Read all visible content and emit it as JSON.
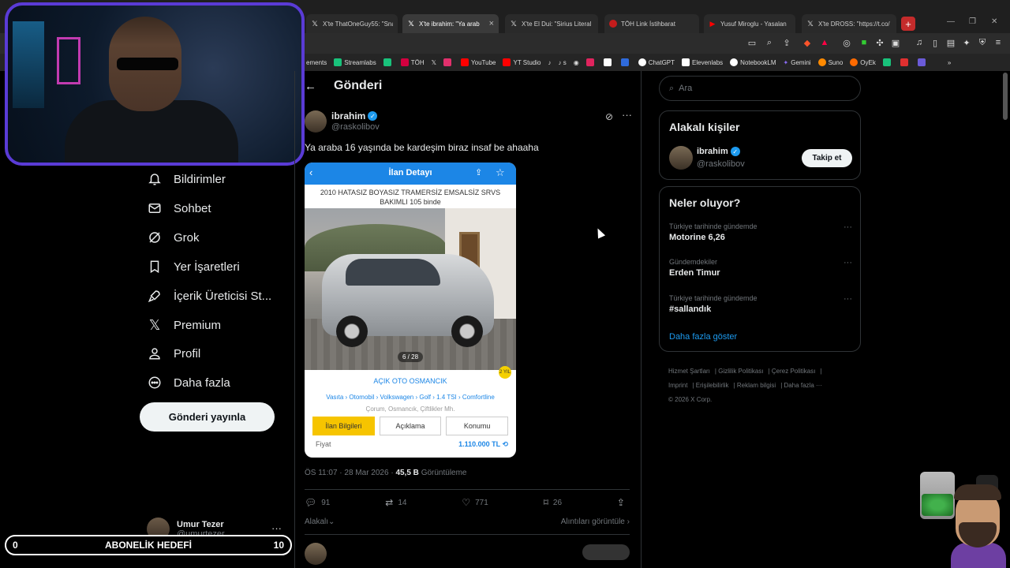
{
  "browser": {
    "tabs": [
      {
        "title": "X'te ThatOneGuy55: \"Snap",
        "active": false
      },
      {
        "title": "X'te ibrahim: \"Ya arab",
        "active": true
      },
      {
        "title": "X'te El Dui: \"Sirius Literal E",
        "active": false
      },
      {
        "title": "TÖH Link İstihbarat",
        "active": false
      },
      {
        "title": "Yusuf Miroglu - Yasalan",
        "active": false
      },
      {
        "title": "X'te DROSS: \"https://t.co/",
        "active": false
      }
    ],
    "bookmarks": [
      "ements",
      "Streamlabs",
      "TÖH",
      "YouTube",
      "YT Studio",
      "s",
      "ChatGPT",
      "Elevenlabs",
      "NotebookLM",
      "Gemini",
      "Suno",
      "OyEk"
    ],
    "bookmark_colors": [
      "#888888",
      "#19c27b",
      "#19c27b",
      "#d3003f",
      "#ffffff",
      "#ff0000",
      "#ff0000",
      "#444444",
      "#ffffff",
      "#ffffff",
      "#ffffff",
      "#8a6cf7",
      "#ff8a00",
      "#ff6a00"
    ]
  },
  "nav": {
    "items": [
      {
        "label": "Bildirimler",
        "icon": "bell-icon"
      },
      {
        "label": "Sohbet",
        "icon": "mail-icon"
      },
      {
        "label": "Grok",
        "icon": "grok-icon"
      },
      {
        "label": "Yer İşaretleri",
        "icon": "bookmark-icon"
      },
      {
        "label": "İçerik Üreticisi St...",
        "icon": "rocket-icon"
      },
      {
        "label": "Premium",
        "icon": "x-logo-icon"
      },
      {
        "label": "Profil",
        "icon": "person-icon"
      },
      {
        "label": "Daha fazla",
        "icon": "more-circle-icon"
      }
    ],
    "post_button": "Gönderi yayınla",
    "account": {
      "name": "Umur Tezer",
      "handle": "@umurtezer"
    }
  },
  "overlay": {
    "goal_left": "0",
    "goal_label": "ABONELİK HEDEFİ",
    "goal_right": "10",
    "goal_progress": 0
  },
  "post": {
    "page_title": "Gönderi",
    "author": "ibrahim",
    "handle": "@raskolibov",
    "text": "Ya araba 16 yaşında be kardeşim biraz insaf be ahaaha",
    "embed": {
      "header": "İlan Detayı",
      "title": "2010 HATASIZ BOYASIZ TRAMERSİZ EMSALSİZ SRVS BAKIMLI 105 binde",
      "photo_counter": "6 / 28",
      "dealer": "AÇIK OTO OSMANCIK",
      "breadcrumb": "Vasıta › Otomobil › Volkswagen › Golf › 1.4 TSI › Comfortline",
      "location": "Çorum, Osmancık, Çiftlikler Mh.",
      "tabs": [
        "İlan Bilgileri",
        "Açıklama",
        "Konumu"
      ],
      "price_label": "Fiyat",
      "price_value": "1.110.000 TL",
      "badge": "2 YIL"
    },
    "timestamp": "ÖS 11:07 · 28 Mar 2026 ·",
    "views_value": "45,5 B",
    "views_label": "Görüntüleme",
    "stats": {
      "replies": "91",
      "reposts": "14",
      "likes": "771",
      "bookmarks": "26"
    },
    "related_label": "Alakalı",
    "quotes_label": "Alıntıları görüntüle"
  },
  "sidebar": {
    "search_placeholder": "Ara",
    "related_title": "Alakalı kişiler",
    "related_user": {
      "name": "ibrahim",
      "handle": "@raskolibov",
      "button": "Takip et"
    },
    "trends_title": "Neler oluyor?",
    "trends": [
      {
        "context": "Türkiye tarihinde gündemde",
        "topic": "Motorine 6,26"
      },
      {
        "context": "Gündemdekiler",
        "topic": "Erden Timur"
      },
      {
        "context": "Türkiye tarihinde gündemde",
        "topic": "#sallandık"
      }
    ],
    "show_more": "Daha fazla göster",
    "footer": [
      "Hizmet Şartları",
      "Gizlilik Politikası",
      "Çerez Politikası",
      "Imprint",
      "Erişilebilirlik",
      "Reklam bilgisi",
      "Daha fazla ···",
      "© 2026 X Corp."
    ]
  },
  "colors": {
    "accent": "#1d9bf0",
    "webcam_border": "#5a3bd6",
    "sahibinden_blue": "#1c86e6",
    "sahibinden_yellow": "#f6c400"
  }
}
